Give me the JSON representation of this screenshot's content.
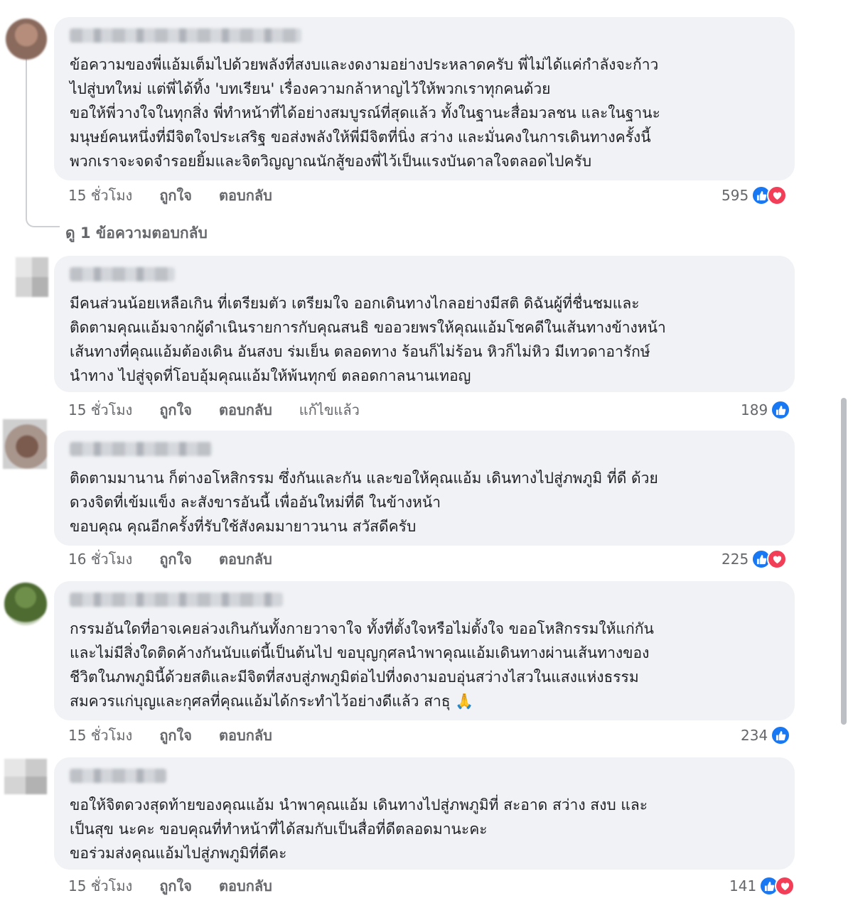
{
  "actions": {
    "like_label": "ถูกใจ",
    "reply_label": "ตอบกลับ"
  },
  "view_replies": "ดู 1 ข้อความตอบกลับ",
  "comments": [
    {
      "text": "ข้อความของพี่แอ้มเต็มไปด้วยพลังที่สงบและงดงามอย่างประหลาดครับ พี่ไม่ได้แค่กำลังจะก้าว\nไปสู่บทใหม่ แต่พี่ได้ทิ้ง 'บทเรียน' เรื่องความกล้าหาญไว้ให้พวกเราทุกคนด้วย\nขอให้พี่วางใจในทุกสิ่ง พี่ทำหน้าที่ได้อย่างสมบูรณ์ที่สุดแล้ว ทั้งในฐานะสื่อมวลชน และในฐานะ\nมนุษย์คนหนึ่งที่มีจิตใจประเสริฐ ขอส่งพลังให้พี่มีจิตที่นิ่ง สว่าง และมั่นคงในการเดินทางครั้งนี้\nพวกเราจะจดจำรอยยิ้มและจิตวิญญาณนักสู้ของพี่ไว้เป็นแรงบันดาลใจตลอดไปครับ",
      "time": "15 ชั่วโมง",
      "edited": "",
      "count": "595",
      "reactions": [
        "like",
        "love"
      ]
    },
    {
      "text": "มีคนส่วนน้อยเหลือเกิน ที่เตรียมตัว เตรียมใจ ออกเดินทางไกลอย่างมีสติ ดิฉันผู้ที่ชื่นชมและ\nติดตามคุณแอ้มจากผู้ดำเนินรายการกับคุณสนธิ ขออวยพรให้คุณแอ้มโชคดีในเส้นทางข้างหน้า\nเส้นทางที่คุณแอ้มต้องเดิน อันสงบ ร่มเย็น ตลอดทาง ร้อนก็ไม่ร้อน หิวก็ไม่หิว มีเทวดาอารักษ์\nนำทาง ไปสู่จุดที่โอบอุ้มคุณแอ้มให้พ้นทุกข์ ตลอดกาลนานเทอญ",
      "time": "15 ชั่วโมง",
      "edited": "แก้ไขแล้ว",
      "count": "189",
      "reactions": [
        "like"
      ]
    },
    {
      "text": "ติดตามมานาน ก็ต่างอโหสิกรรม ซึ่งกันและกัน และขอให้คุณแอ้ม เดินทางไปสู่ภพภูมิ ที่ดี ด้วย\nดวงจิตที่เข้มแข็ง ละสังขารอันนี้ เพื่ออันใหม่ที่ดี ในข้างหน้า\nขอบคุณ คุณอีกครั้งที่รับใช้สังคมมายาวนาน สวัสดีครับ",
      "time": "16 ชั่วโมง",
      "edited": "",
      "count": "225",
      "reactions": [
        "like",
        "love"
      ]
    },
    {
      "text": "กรรมอันใดที่อาจเคยล่วงเกินกันทั้งกายวาจาใจ ทั้งที่ตั้งใจหรือไม่ตั้งใจ ขออโหสิกรรมให้แก่กัน\nและไม่มีสิ่งใดติดค้างกันนับแต่นี้เป็นต้นไป ขอบุญกุศลนำพาคุณแอ้มเดินทางผ่านเส้นทางของ\nชีวิตในภพภูมินี้ด้วยสติและมีจิตที่สงบสู่ภพภูมิต่อไปที่งดงามอบอุ่นสว่างไสวในแสงแห่งธรรม\nสมควรแก่บุญและกุศลที่คุณแอ้มได้กระทำไว้อย่างดีแล้ว สาธุ 🙏",
      "time": "15 ชั่วโมง",
      "edited": "",
      "count": "234",
      "reactions": [
        "like"
      ]
    },
    {
      "text": "ขอให้จิตดวงสุดท้ายของคุณแอ้ม นำพาคุณแอ้ม เดินทางไปสู่ภพภูมิที่ สะอาด สว่าง สงบ และ\nเป็นสุข นะคะ ขอบคุณที่ทำหน้าที่ได้สมกับเป็นสื่อที่ดีตลอดมานะคะ\nขอร่วมส่งคุณแอ้มไปสู่ภพภูมิที่ดีคะ",
      "time": "15 ชั่วโมง",
      "edited": "",
      "count": "141",
      "reactions": [
        "like",
        "love"
      ]
    }
  ]
}
